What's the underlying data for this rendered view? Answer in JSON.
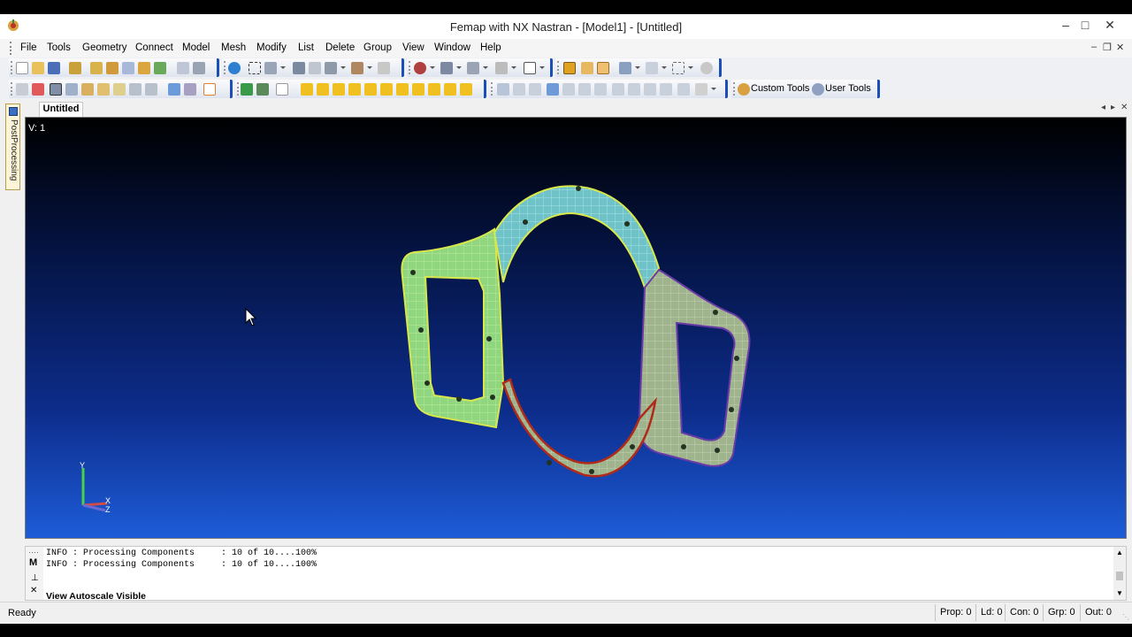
{
  "window": {
    "title": "Femap with NX Nastran - [Model1] - [Untitled]"
  },
  "menu": [
    "File",
    "Tools",
    "Geometry",
    "Connect",
    "Model",
    "Mesh",
    "Modify",
    "List",
    "Delete",
    "Group",
    "View",
    "Window",
    "Help"
  ],
  "toolbar": {
    "custom_tools_label": "Custom Tools",
    "user_tools_label": "User Tools"
  },
  "tabs": {
    "active": "Untitled"
  },
  "side_panel": {
    "label": "PostProcessing"
  },
  "viewport": {
    "view_label": "V: 1",
    "axis_labels": {
      "x": "X",
      "y": "Y",
      "z": "Z"
    }
  },
  "messages": {
    "lines": [
      "INFO : Processing Components     : 10 of 10....100%",
      "INFO : Processing Components     : 10 of 10....100%"
    ],
    "command": "View Autoscale Visible"
  },
  "status": {
    "ready": "Ready",
    "prop": "Prop: 0",
    "ld": "Ld: 0",
    "con": "Con: 0",
    "grp": "Grp: 0",
    "out": "Out: 0"
  },
  "colors": {
    "mesh_green": "#8fd67e",
    "mesh_cyan": "#6fc3c8",
    "mesh_grey": "#9fb38d",
    "edge_red": "#b02a1a",
    "edge_purple": "#6a3aa8",
    "toolbar_accent": "#1b4fb5"
  }
}
